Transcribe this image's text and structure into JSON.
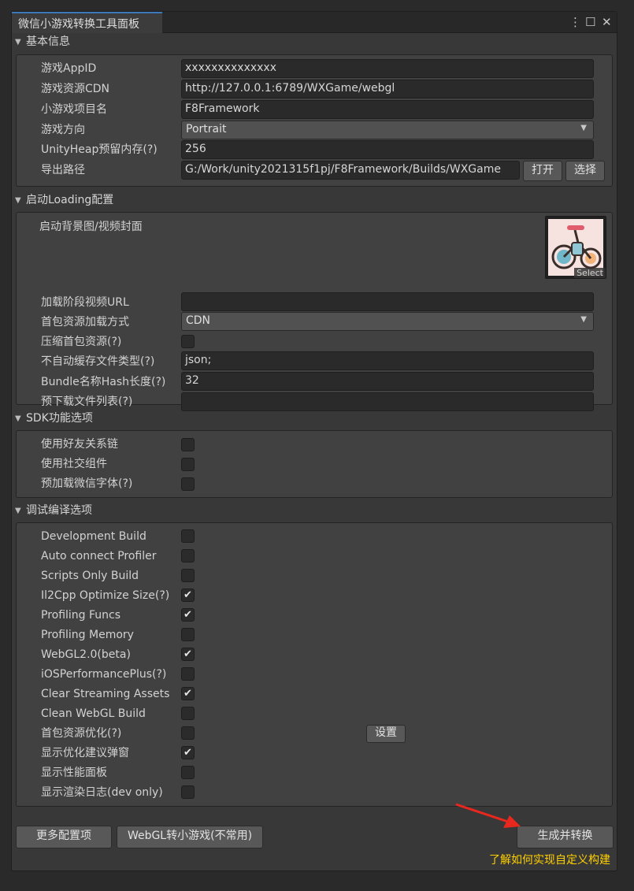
{
  "window": {
    "tab_title": "微信小游戏转换工具面板"
  },
  "sections": {
    "basic": {
      "title": "基本信息",
      "appid_label": "游戏AppID",
      "appid_value": "xxxxxxxxxxxxxx",
      "cdn_label": "游戏资源CDN",
      "cdn_value": "http://127.0.0.1:6789/WXGame/webgl",
      "name_label": "小游戏项目名",
      "name_value": "F8Framework",
      "orient_label": "游戏方向",
      "orient_value": "Portrait",
      "heap_label": "UnityHeap预留内存(?)",
      "heap_value": "256",
      "path_label": "导出路径",
      "path_value": "G:/Work/unity2021315f1pj/F8Framework/Builds/WXGame",
      "open_button": "打开",
      "choose_button": "选择"
    },
    "loading": {
      "title": "启动Loading配置",
      "bg_label": "启动背景图/视频封面",
      "select_label": "Select",
      "video_url_label": "加载阶段视频URL",
      "video_url_value": "",
      "load_mode_label": "首包资源加载方式",
      "load_mode_value": "CDN",
      "compress_label": "压缩首包资源(?)",
      "nocache_label": "不自动缓存文件类型(?)",
      "nocache_value": "json;",
      "hash_label": "Bundle名称Hash长度(?)",
      "hash_value": "32",
      "preload_label": "预下载文件列表(?)",
      "preload_value": ""
    },
    "sdk": {
      "title": "SDK功能选项",
      "friend_label": "使用好友关系链",
      "social_label": "使用社交组件",
      "font_label": "预加载微信字体(?)"
    },
    "debug": {
      "title": "调试编译选项",
      "options": [
        {
          "label": "Development Build",
          "checked": false
        },
        {
          "label": "Auto connect Profiler",
          "checked": false
        },
        {
          "label": "Scripts Only Build",
          "checked": false
        },
        {
          "label": "Il2Cpp Optimize Size(?)",
          "checked": true
        },
        {
          "label": "Profiling Funcs",
          "checked": true
        },
        {
          "label": "Profiling Memory",
          "checked": false
        },
        {
          "label": "WebGL2.0(beta)",
          "checked": true
        },
        {
          "label": "iOSPerformancePlus(?)",
          "checked": false
        },
        {
          "label": "Clear Streaming Assets",
          "checked": true
        },
        {
          "label": "Clean WebGL Build",
          "checked": false
        },
        {
          "label": "首包资源优化(?)",
          "checked": false
        },
        {
          "label": "显示优化建议弹窗",
          "checked": true
        },
        {
          "label": "显示性能面板",
          "checked": false
        },
        {
          "label": "显示渲染日志(dev only)",
          "checked": false
        }
      ],
      "settings_button": "设置"
    }
  },
  "footer": {
    "more_button": "更多配置项",
    "webgl_button": "WebGL转小游戏(不常用)",
    "build_button": "生成并转换",
    "custom_link": "了解如何实现自定义构建"
  },
  "colors": {
    "accent_tab": "#3a79bb",
    "link": "#ffd000",
    "arrow": "#e8281e"
  }
}
